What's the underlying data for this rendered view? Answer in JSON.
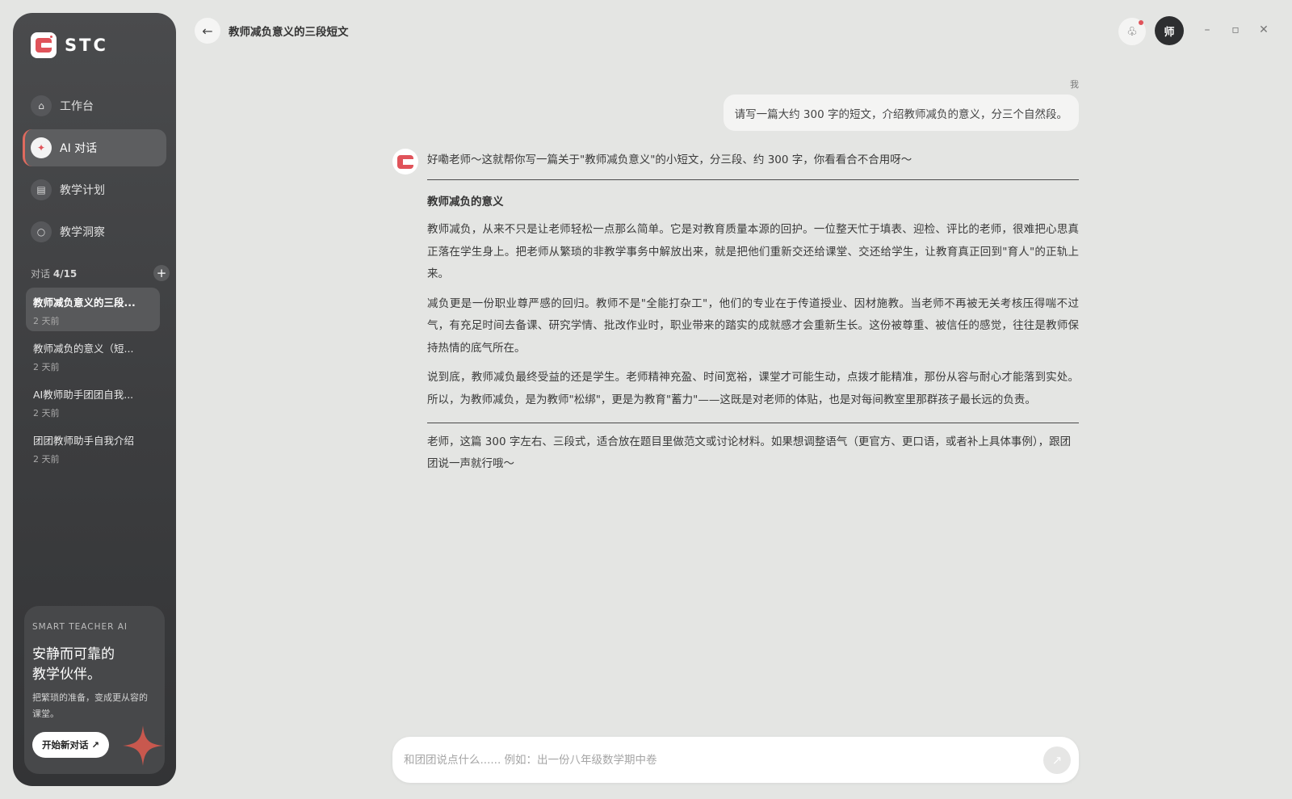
{
  "app": {
    "brand": "STC",
    "accent_color": "#e0535a",
    "sidebar_bg": "#3f4042"
  },
  "sidebar": {
    "nav": [
      {
        "label": "工作台",
        "icon": "home-icon",
        "active": false
      },
      {
        "label": "AI 对话",
        "icon": "sparkle-icon",
        "active": true
      },
      {
        "label": "教学计划",
        "icon": "document-icon",
        "active": false
      },
      {
        "label": "教学洞察",
        "icon": "circle-icon",
        "active": false
      }
    ],
    "conversations_label": "对话",
    "conversations_count": "4/15",
    "conversations": [
      {
        "title": "教师减负意义的三段...",
        "time": "2 天前",
        "active": true
      },
      {
        "title": "教师减负的意义（短...",
        "time": "2 天前",
        "active": false
      },
      {
        "title": "AI教师助手团团自我...",
        "time": "2 天前",
        "active": false
      },
      {
        "title": "团团教师助手自我介绍",
        "time": "2 天前",
        "active": false
      }
    ],
    "promo": {
      "kicker": "SMART TEACHER AI",
      "title_line1": "安静而可靠的",
      "title_line2": "教学伙伴。",
      "desc": "把繁琐的准备，变成更从容的课堂。",
      "button": "开始新对话 ↗"
    }
  },
  "header": {
    "back_icon": "←",
    "title": "教师减负意义的三段短文",
    "notify_icon": "♧",
    "avatar_text": "师",
    "window_controls": [
      "–",
      "▫",
      "✕"
    ]
  },
  "chat": {
    "user_label": "我",
    "user_message": "请写一篇大约 300 字的短文，介绍教师减负的意义，分三个自然段。",
    "bot_intro": "好嘞老师～这就帮你写一篇关于\"教师减负意义\"的小短文，分三段、约 300 字，你看看合不合用呀～",
    "article_title": "教师减负的意义",
    "paragraphs": [
      "教师减负，从来不只是让老师轻松一点那么简单。它是对教育质量本源的回护。一位整天忙于填表、迎检、评比的老师，很难把心思真正落在学生身上。把老师从繁琐的非教学事务中解放出来，就是把他们重新交还给课堂、交还给学生，让教育真正回到\"育人\"的正轨上来。",
      "减负更是一份职业尊严感的回归。教师不是\"全能打杂工\"，他们的专业在于传道授业、因材施教。当老师不再被无关考核压得喘不过气，有充足时间去备课、研究学情、批改作业时，职业带来的踏实的成就感才会重新生长。这份被尊重、被信任的感觉，往往是教师保持热情的底气所在。",
      "说到底，教师减负最终受益的还是学生。老师精神充盈、时间宽裕，课堂才可能生动，点拨才能精准，那份从容与耐心才能落到实处。所以，为教师减负，是为教师\"松绑\"，更是为教育\"蓄力\"——这既是对老师的体贴，也是对每间教室里那群孩子最长远的负责。"
    ],
    "outro": "老师，这篇 300 字左右、三段式，适合放在题目里做范文或讨论材料。如果想调整语气（更官方、更口语，或者补上具体事例），跟团团说一声就行哦～"
  },
  "composer": {
    "placeholder": "和团团说点什么...... 例如：出一份八年级数学期中卷",
    "value": "",
    "send_icon": "↗"
  }
}
